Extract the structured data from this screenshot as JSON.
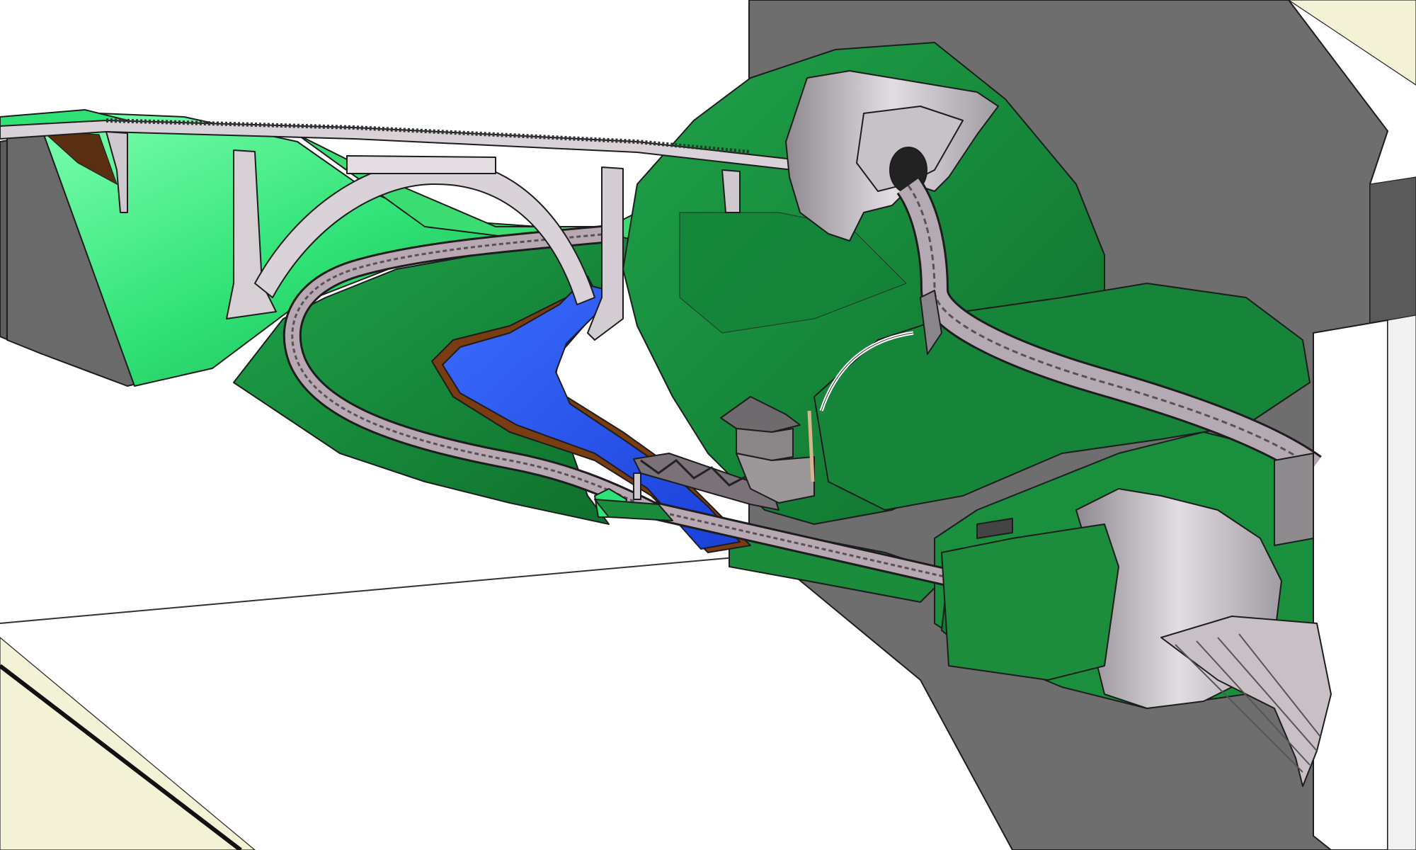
{
  "scene": {
    "kind": "3d-model-railway-layout-render",
    "elements": [
      "room-walls",
      "mountain-terrain",
      "arch-viaduct",
      "truss-bridge",
      "river",
      "tunnel-portals",
      "track-loops",
      "station-hut"
    ],
    "colors": {
      "background": "#ffffff",
      "wall_grey": "#6e6e6e",
      "wall_dark": "#565656",
      "floor_tint": "#f4f3dc",
      "terrain_light": "#38e87a",
      "terrain_mid": "#1f9c45",
      "terrain_dark": "#137a32",
      "river": "#2a55f0",
      "river_bank": "#7a3d12",
      "track_bed": "#b8a8b2",
      "stone": "#c9c4c8",
      "viaduct": "#d9d2d8"
    }
  }
}
